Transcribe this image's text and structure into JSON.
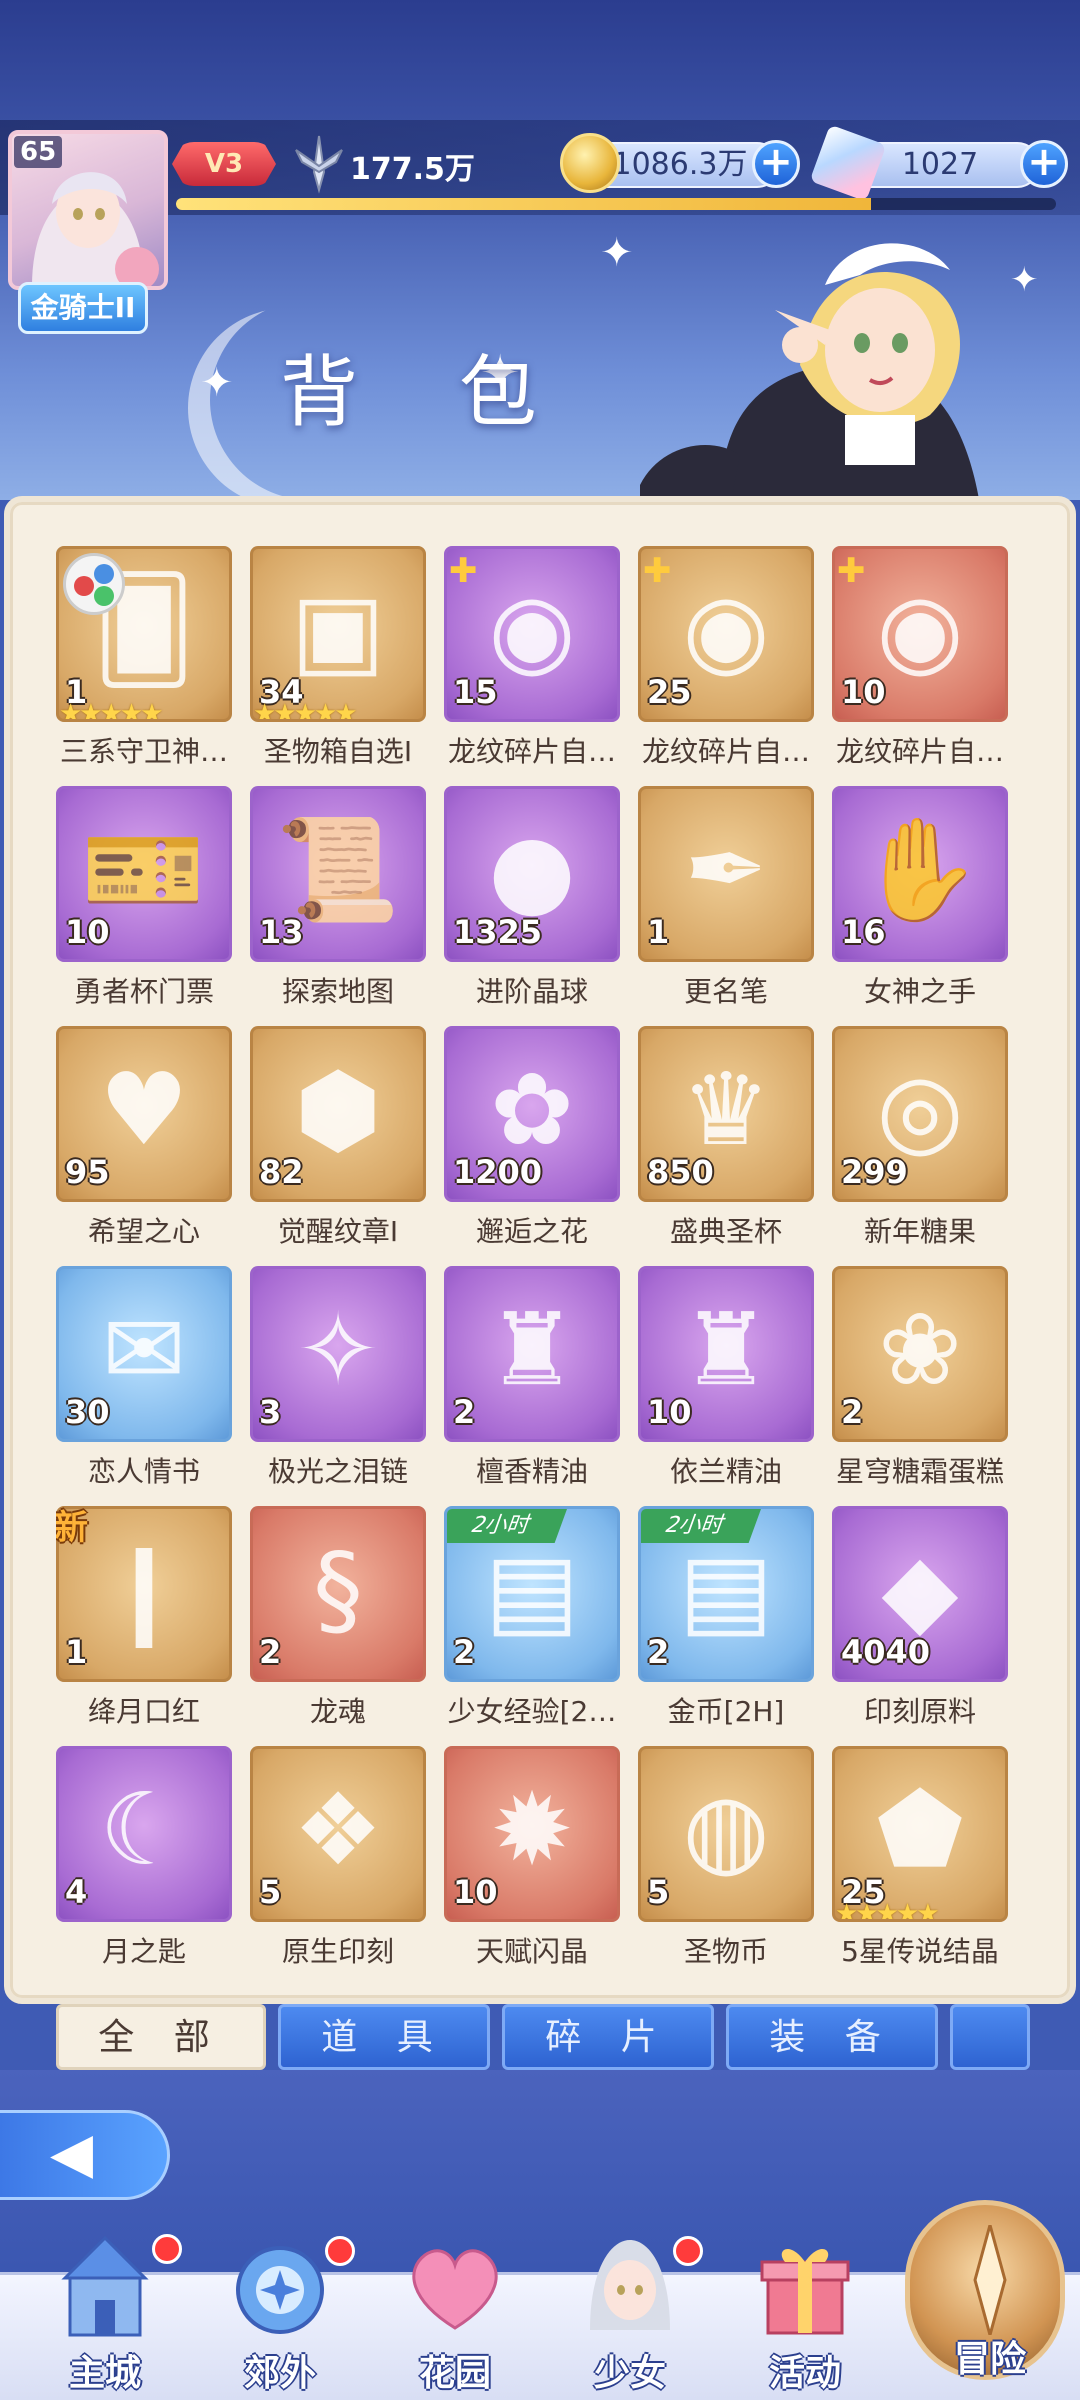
{
  "header": {
    "level": "65",
    "rank": "金骑士II",
    "vip": "V3",
    "power": "177.5万",
    "gold": "1086.3万",
    "gems": "1027",
    "exp_fraction": 0.79,
    "title": "背 包"
  },
  "items": [
    {
      "name": "三系守卫神…",
      "count": "1",
      "rarity": "gold",
      "icon": "card-stack-icon",
      "stars": 5,
      "badge": "tri-color"
    },
    {
      "name": "圣物箱自选Ⅰ",
      "count": "34",
      "rarity": "gold",
      "icon": "chest-icon",
      "stars": 5
    },
    {
      "name": "龙纹碎片自…",
      "count": "15",
      "rarity": "purple",
      "icon": "fragment-icon",
      "badge": "puzzle"
    },
    {
      "name": "龙纹碎片自…",
      "count": "25",
      "rarity": "gold",
      "icon": "fragment-icon",
      "badge": "puzzle"
    },
    {
      "name": "龙纹碎片自…",
      "count": "10",
      "rarity": "red",
      "icon": "fragment-icon",
      "badge": "puzzle"
    },
    {
      "name": "勇者杯门票",
      "count": "10",
      "rarity": "purple",
      "icon": "ticket-icon"
    },
    {
      "name": "探索地图",
      "count": "13",
      "rarity": "purple",
      "icon": "map-scroll-icon"
    },
    {
      "name": "进阶晶球",
      "count": "1325",
      "rarity": "purple",
      "icon": "crystal-ball-icon"
    },
    {
      "name": "更名笔",
      "count": "1",
      "rarity": "gold",
      "icon": "quill-icon"
    },
    {
      "name": "女神之手",
      "count": "16",
      "rarity": "purple",
      "icon": "hand-icon"
    },
    {
      "name": "希望之心",
      "count": "95",
      "rarity": "gold",
      "icon": "heart-icon"
    },
    {
      "name": "觉醒纹章Ⅰ",
      "count": "82",
      "rarity": "gold",
      "icon": "emblem-icon"
    },
    {
      "name": "邂逅之花",
      "count": "1200",
      "rarity": "purple",
      "icon": "rose-icon"
    },
    {
      "name": "盛典圣杯",
      "count": "850",
      "rarity": "gold",
      "icon": "goblet-icon"
    },
    {
      "name": "新年糖果",
      "count": "299",
      "rarity": "gold",
      "icon": "lollipop-icon"
    },
    {
      "name": "恋人情书",
      "count": "30",
      "rarity": "blue",
      "icon": "love-letter-icon"
    },
    {
      "name": "极光之泪链",
      "count": "3",
      "rarity": "purple",
      "icon": "necklace-icon"
    },
    {
      "name": "檀香精油",
      "count": "2",
      "rarity": "purple",
      "icon": "perfume-bottle-icon"
    },
    {
      "name": "依兰精油",
      "count": "10",
      "rarity": "purple",
      "icon": "perfume-bottle-icon"
    },
    {
      "name": "星穹糖霜蛋糕",
      "count": "2",
      "rarity": "gold",
      "icon": "cake-icon"
    },
    {
      "name": "绛月口红",
      "count": "1",
      "rarity": "gold",
      "icon": "lipstick-icon",
      "badge": "new",
      "badge_text": "新"
    },
    {
      "name": "龙魂",
      "count": "2",
      "rarity": "red",
      "icon": "dragon-icon"
    },
    {
      "name": "少女经验[2…",
      "count": "2",
      "rarity": "blue",
      "icon": "treasure-chest-icon",
      "badge": "time",
      "badge_text": "2小时"
    },
    {
      "name": "金币[2H]",
      "count": "2",
      "rarity": "blue",
      "icon": "treasure-chest-icon",
      "badge": "time",
      "badge_text": "2小时"
    },
    {
      "name": "印刻原料",
      "count": "4040",
      "rarity": "purple",
      "icon": "ore-icon"
    },
    {
      "name": "月之匙",
      "count": "4",
      "rarity": "purple",
      "icon": "moon-key-icon"
    },
    {
      "name": "原生印刻",
      "count": "5",
      "rarity": "gold",
      "icon": "crystal-icon"
    },
    {
      "name": "天赋闪晶",
      "count": "10",
      "rarity": "red",
      "icon": "talent-gem-icon"
    },
    {
      "name": "圣物币",
      "count": "5",
      "rarity": "gold",
      "icon": "lips-coin-icon"
    },
    {
      "name": "5星传说结晶",
      "count": "25",
      "rarity": "gold",
      "icon": "legend-crystal-icon",
      "stars": 5
    }
  ],
  "tabs": [
    {
      "label": "全 部",
      "active": true
    },
    {
      "label": "道 具"
    },
    {
      "label": "碎 片"
    },
    {
      "label": "装 备"
    }
  ],
  "nav": [
    {
      "label": "主城",
      "icon": "castle-icon",
      "dot": true
    },
    {
      "label": "郊外",
      "icon": "portal-icon",
      "dot": true
    },
    {
      "label": "花园",
      "icon": "heart-garden-icon",
      "dot": false
    },
    {
      "label": "少女",
      "icon": "girl-portrait-icon",
      "dot": true
    },
    {
      "label": "活动",
      "icon": "gift-icon",
      "dot": false
    },
    {
      "label": "冒险",
      "icon": "compass-icon",
      "dot": false
    }
  ],
  "colors": {
    "gold": "#d8a867",
    "purple": "#a86bd3",
    "red": "#d97a68",
    "blue": "#7fb8ec",
    "tab_active": "#f6efe2",
    "tab_normal": "#2e63d1"
  }
}
